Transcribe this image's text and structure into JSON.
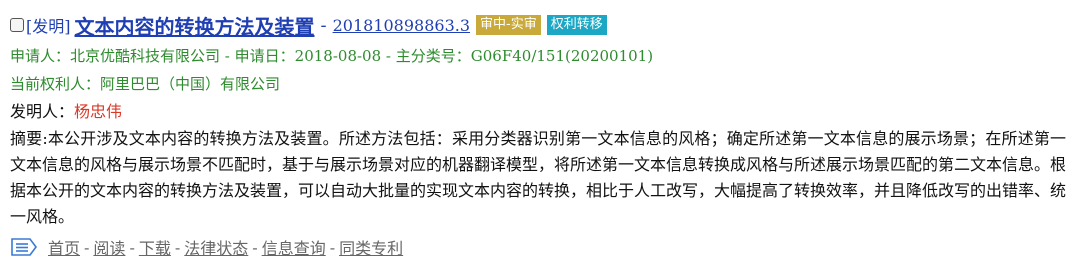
{
  "record": {
    "type_tag": "[发明]",
    "title": "文本内容的转换方法及装置",
    "title_dash": "-",
    "pub_number": "201810898863.3",
    "badges": {
      "status": "审中-实审",
      "transfer": "权利转移"
    }
  },
  "meta": {
    "applicant_label": "申请人：",
    "applicant": "北京优酷科技有限公司",
    "sep1": " - ",
    "apply_date_label": "申请日：",
    "apply_date": "2018-08-08",
    "sep2": " - ",
    "class_label": "主分类号：",
    "class_no": "G06F40/151(20200101)",
    "owner_label": "当前权利人：",
    "owner": "阿里巴巴（中国）有限公司",
    "inventor_label": "发明人：",
    "inventor": "杨忠伟"
  },
  "abstract": {
    "text": "摘要:本公开涉及文本内容的转换方法及装置。所述方法包括：采用分类器识别第一文本信息的风格；确定所述第一文本信息的展示场景；在所述第一文本信息的风格与展示场景不匹配时，基于与展示场景对应的机器翻译模型，将所述第一文本信息转换成风格与所述展示场景匹配的第二文本信息。根据本公开的文本内容的转换方法及装置，可以自动大批量的实现文本内容的转换，相比于人工改写，大幅提高了转换效率，并且降低改写的出错率、统一风格。"
  },
  "actions": {
    "first_page": "首页",
    "read": "阅读",
    "download": "下载",
    "legal_status": "法律状态",
    "info_query": "信息查询",
    "similar": "同类专利",
    "sep": "-"
  },
  "colors": {
    "link_blue": "#1f3fb3",
    "meta_green": "#2e8b2e",
    "inventor_red": "#d83a2a",
    "badge_status": "#c9a93a",
    "badge_transfer": "#1ca7c4"
  }
}
